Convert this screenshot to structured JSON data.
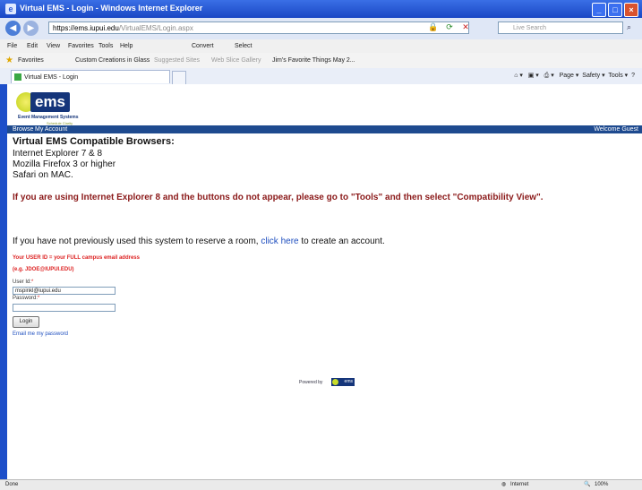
{
  "window": {
    "title": "Virtual EMS - Login - Windows Internet Explorer"
  },
  "address_bar": {
    "protocol": "https://",
    "host": "ems.iupui.edu",
    "path": "/VirtualEMS/Login.aspx",
    "search_placeholder": "Live Search"
  },
  "menu": {
    "items": [
      "File",
      "Edit",
      "View",
      "Favorites",
      "Tools",
      "Help"
    ],
    "convert": "Convert",
    "select": "Select"
  },
  "favorites_bar": {
    "favorites": "Favorites",
    "items": [
      "Custom Creations in Glass",
      "Suggested Sites",
      "Web Slice Gallery",
      "Jim's Favorite Things May 2..."
    ]
  },
  "tab": {
    "label": "Virtual EMS - Login"
  },
  "command_bar": {
    "items": [
      "Page",
      "Safety",
      "Tools"
    ]
  },
  "logo": {
    "text": "ems",
    "line1": "Event Management Systems",
    "line2": "Schedule Clarity"
  },
  "nav": {
    "browse": "Browse",
    "my_account": "My Account",
    "welcome": "Welcome Guest"
  },
  "content": {
    "heading": "Virtual EMS Compatible Browsers:",
    "browsers": [
      "Internet Explorer 7 & 8",
      "Mozilla Firefox 3 or higher",
      "Safari on MAC."
    ],
    "warning": "If you are using Internet Explorer 8 and the buttons do not appear, please go to \"Tools\" and then select \"Compatibility View\".",
    "info_before": "If you have not previously used this system to reserve a room,",
    "info_link": "click here",
    "info_after": "to create an account.",
    "userid_note": "Your USER ID = your FULL campus email address",
    "userid_example": "(e.g. JDOE@IUPUI.EDU)",
    "userid_label": "User Id:",
    "userid_value": "mspinkl@iupui.edu",
    "password_label": "Password:",
    "password_value": "",
    "login_button": "Login",
    "email_link": "Email me my password",
    "powered_by": "Powered by"
  },
  "status": {
    "left": "Done",
    "zone": "Internet",
    "zoom": "100%"
  }
}
